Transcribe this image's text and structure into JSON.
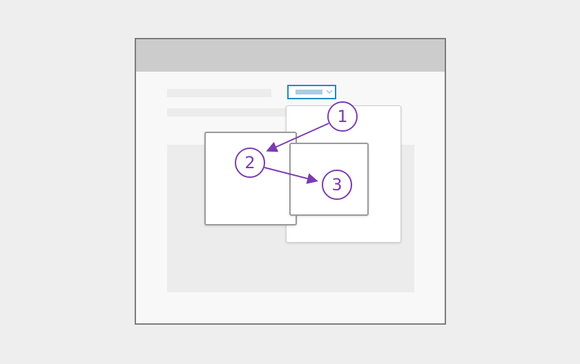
{
  "accent_color": "#7b3bb0",
  "focus_color": "#1e88c7",
  "steps": [
    {
      "label": "1"
    },
    {
      "label": "2"
    },
    {
      "label": "3"
    }
  ],
  "icons": {
    "dropdown": "chevron-down-icon",
    "arrows": "arrow-icon"
  }
}
